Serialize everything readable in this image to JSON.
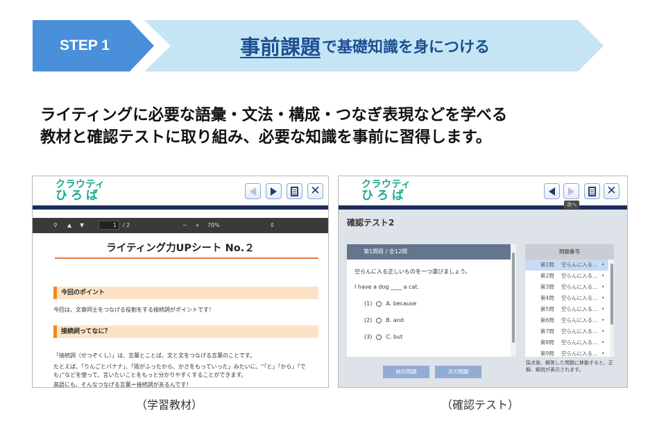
{
  "banner": {
    "step_label": "STEP 1",
    "title_main": "事前課題",
    "title_rest": "で基礎知識を身につける"
  },
  "intro": {
    "line1": "ライティングに必要な語彙・文法・構成・つなぎ表現などを学べる",
    "line2": "教材と確認テストに取り組み、必要な知識を事前に習得します。"
  },
  "app": {
    "logo_line1": "クラウティ",
    "logo_line2": "ひろば"
  },
  "left_panel": {
    "pdf_toolbar": {
      "page_current": "1",
      "page_total": "/ 2",
      "zoom_minus": "−",
      "zoom_plus": "+",
      "zoom": "70%"
    },
    "sheet_title": "ライティング力UPシート No.２",
    "section1_heading": "今回のポイント",
    "section1_text": "今回は、文章同士をつなげる役割をする接続詞がポイントです！",
    "section2_heading": "接続詞ってなに？",
    "body_line1": "「接続詞（せつぞくし）」は、言葉とことば、文と文をつなげる言葉のことです。",
    "body_line2": "たとえば、「りんごとバナナ」、「雨がふったから、かさをもっていった」みたいに、“「と」「から」「で",
    "body_line3": "も」”などを使って、言いたいことをもっと分かりやすくすることができます。",
    "body_line4": "英語にも、そんなつなげる言葉＝接続詞があるんです！"
  },
  "right_panel": {
    "tooltip": "次へ",
    "quiz_title": "確認テスト2",
    "question_head": "第1問目 / 全12問",
    "instruction": "空らんに入る正しいものを一つ選びましょう。",
    "question": "I have a dog ____ a cat.",
    "options": [
      {
        "num": "(1)",
        "label": "A. because"
      },
      {
        "num": "(2)",
        "label": "B. and"
      },
      {
        "num": "(3)",
        "label": "C. but"
      }
    ],
    "prev_button": "前の問題",
    "next_button": "次の問題",
    "list_head": "問題番号",
    "list_items": [
      {
        "num": "第1問",
        "text": "空らんに入る…",
        "dot": "•"
      },
      {
        "num": "第2問",
        "text": "空らんに入る…",
        "dot": "•"
      },
      {
        "num": "第3問",
        "text": "空らんに入る…",
        "dot": "•"
      },
      {
        "num": "第4問",
        "text": "空らんに入る…",
        "dot": "•"
      },
      {
        "num": "第5問",
        "text": "空らんに入る…",
        "dot": "•"
      },
      {
        "num": "第6問",
        "text": "空らんに入る…",
        "dot": "•"
      },
      {
        "num": "第7問",
        "text": "空らんに入る…",
        "dot": "•"
      },
      {
        "num": "第8問",
        "text": "空らんに入る…",
        "dot": "•"
      },
      {
        "num": "第9問",
        "text": "空らんに入る…",
        "dot": "•"
      }
    ],
    "list_note": "採点後、解答した問題に移動すると、正解、解説が表示されます。"
  },
  "captions": {
    "left": "（学習教材）",
    "right": "（確認テスト）"
  },
  "colors": {
    "step_badge": "#4a8fda",
    "title_band": "#c5e5f5",
    "title_text": "#1d4f91",
    "logo": "#1aa98d",
    "navy_bar": "#1e2d5e"
  }
}
